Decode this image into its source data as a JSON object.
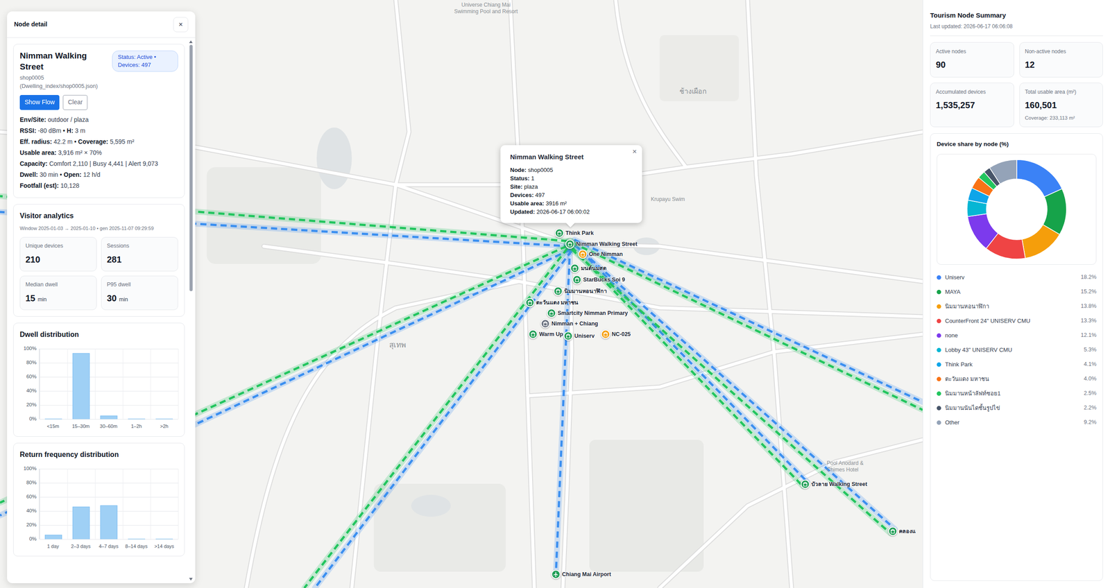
{
  "map": {
    "labels": [
      {
        "text": "Universe Chiang Mai Swimming Pool and Resort"
      },
      {
        "text": "ช้างเผือก"
      },
      {
        "text": "Krupayu Swim"
      },
      {
        "text": "สุเทพ"
      },
      {
        "text": "Pool Anodard & Chimes Hotel"
      }
    ],
    "flows": [
      {
        "color": "#22c55e"
      },
      {
        "color": "#3b8ff0"
      },
      {
        "color": "#22c55e"
      },
      {
        "color": "#3b8ff0"
      },
      {
        "color": "#22c55e"
      },
      {
        "color": "#3b8ff0"
      },
      {
        "color": "#3b8ff0"
      },
      {
        "color": "#22c55e"
      },
      {
        "color": "#3b8ff0"
      },
      {
        "color": "#22c55e"
      },
      {
        "color": "#3b8ff0"
      },
      {
        "color": "#22c55e"
      },
      {
        "color": "#3b8ff0"
      }
    ],
    "pins": [
      {
        "name": "Think Park",
        "color": "#1f9d55",
        "kind": "shop"
      },
      {
        "name": "Nimman Walking Street",
        "color": "#1f9d55",
        "kind": "hub"
      },
      {
        "name": "One Nimman",
        "color": "#f59e0b",
        "kind": "shop"
      },
      {
        "name": "มนต์นมสด",
        "color": "#1f9d55",
        "kind": "shop"
      },
      {
        "name": "StarBucks Soi 9",
        "color": "#1f9d55",
        "kind": "shop"
      },
      {
        "name": "นิมมานหอนาฬิกา",
        "color": "#1f9d55",
        "kind": "shop"
      },
      {
        "name": "ตะวันแดง มหาชน",
        "color": "#1f9d55",
        "kind": "shop"
      },
      {
        "name": "Smartcity Nimman Primary",
        "color": "#1f9d55",
        "kind": "shop"
      },
      {
        "name": "Nimman + Chiang",
        "color": "#6b7280",
        "kind": "shop"
      },
      {
        "name": "Warm Up",
        "color": "#1f9d55",
        "kind": "shop"
      },
      {
        "name": "Uniserv",
        "color": "#1f9d55",
        "kind": "shop"
      },
      {
        "name": "NC-025",
        "color": "#f59e0b",
        "kind": "shop"
      },
      {
        "name": "บัวลาย Walking Street",
        "color": "#1f9d55",
        "kind": "shop"
      },
      {
        "name": "คลองแ",
        "color": "#1f9d55",
        "kind": "shop"
      },
      {
        "name": "Chiang Mai Airport",
        "color": "#1f9d55",
        "kind": "airport"
      }
    ],
    "popup": {
      "title": "Nimman Walking Street",
      "close": "×",
      "rows": [
        {
          "label": "Node:",
          "value": "shop0005"
        },
        {
          "label": "Status:",
          "value": "1"
        },
        {
          "label": "Site:",
          "value": "plaza"
        },
        {
          "label": "Devices:",
          "value": "497"
        },
        {
          "label": "Usable area:",
          "value": "3916 m²"
        },
        {
          "label": "Updated:",
          "value": "2026-06-17 06:00:02"
        }
      ]
    }
  },
  "node_detail": {
    "header": "Node detail",
    "close": "×",
    "title": "Nimman Walking Street",
    "badge": "Status: Active • Devices: 497",
    "node_id": "shop0005",
    "path": "(Dwelling_index/shop0005.json)",
    "buttons": [
      {
        "label": "Show Flow",
        "kind": "primary"
      },
      {
        "label": "Clear",
        "kind": "secondary"
      }
    ],
    "separator": "•",
    "info": [
      {
        "parts": [
          {
            "label": "Env/Site:",
            "value": "outdoor / plaza"
          }
        ]
      },
      {
        "parts": [
          {
            "label": "RSSI:",
            "value": "-80 dBm"
          },
          {
            "label": "H:",
            "value": "3 m"
          }
        ]
      },
      {
        "parts": [
          {
            "label": "Eff. radius:",
            "value": "42.2 m"
          },
          {
            "label": "Coverage:",
            "value": "5,595 m²"
          }
        ]
      },
      {
        "parts": [
          {
            "label": "Usable area:",
            "value": "3,916 m² × 70%"
          }
        ]
      },
      {
        "parts": [
          {
            "label": "Capacity:",
            "value": "Comfort 2,110 | Busy 4,441 | Alert 9,073"
          }
        ]
      },
      {
        "parts": [
          {
            "label": "Dwell:",
            "value": "30 min"
          },
          {
            "label": "Open:",
            "value": "12 h/d"
          }
        ]
      },
      {
        "parts": [
          {
            "label": "Footfall (est):",
            "value": "10,128"
          }
        ]
      }
    ]
  },
  "visitor": {
    "title": "Visitor analytics",
    "window": "Window 2025-01-03 → 2025-01-10 • gen 2025-11-07 09:29:59",
    "stats": [
      {
        "label": "Unique devices",
        "value": "210"
      },
      {
        "label": "Sessions",
        "value": "281"
      },
      {
        "label": "Median dwell",
        "value": "15",
        "unit": "min"
      },
      {
        "label": "P95 dwell",
        "value": "30",
        "unit": "min"
      }
    ]
  },
  "charts": [
    {
      "title": "Dwell distribution",
      "y_ticks": [
        "100%",
        "80%",
        "60%",
        "40%",
        "20%",
        "0%"
      ],
      "categories": [
        "<15m",
        "15–30m",
        "30–60m",
        "1–2h",
        ">2h"
      ],
      "values": [
        0,
        94,
        5,
        0,
        0
      ]
    },
    {
      "title": "Return frequency distribution",
      "y_ticks": [
        "100%",
        "80%",
        "60%",
        "40%",
        "20%",
        "0%"
      ],
      "categories": [
        "1 day",
        "2–3 days",
        "4–7 days",
        "8–14 days",
        ">14 days"
      ],
      "values": [
        6,
        46,
        48,
        0,
        0
      ]
    }
  ],
  "summary": {
    "title": "Tourism Node Summary",
    "updated": "Last updated: 2026-06-17 06:06:08",
    "stats": [
      {
        "label": "Active nodes",
        "value": "90"
      },
      {
        "label": "Non-active nodes",
        "value": "12"
      },
      {
        "label": "Accumulated devices",
        "value": "1,535,257"
      },
      {
        "label": "Total usable area (m²)",
        "value": "160,501",
        "note": "Coverage: 233,113 m²"
      }
    ],
    "share": {
      "title": "Device share by node (%)",
      "items": [
        {
          "name": "Uniserv",
          "pct": "18.2%",
          "value": 18.2,
          "color": "#3b82f6"
        },
        {
          "name": "MAYA",
          "pct": "15.2%",
          "value": 15.2,
          "color": "#16a34a"
        },
        {
          "name": "นิมมานหอนาฬิกา",
          "pct": "13.8%",
          "value": 13.8,
          "color": "#f59e0b"
        },
        {
          "name": "CounterFront 24\" UNISERV CMU",
          "pct": "13.3%",
          "value": 13.3,
          "color": "#ef4444"
        },
        {
          "name": "none",
          "pct": "12.1%",
          "value": 12.1,
          "color": "#7c3aed"
        },
        {
          "name": "Lobby 43\" UNISERV CMU",
          "pct": "5.3%",
          "value": 5.3,
          "color": "#06b6d4"
        },
        {
          "name": "Think Park",
          "pct": "4.1%",
          "value": 4.1,
          "color": "#0ea5e9"
        },
        {
          "name": "ตะวันแดง มหาชน",
          "pct": "4.0%",
          "value": 4.0,
          "color": "#f97316"
        },
        {
          "name": "นิมมานหน้าลัฟท์ซอย1",
          "pct": "2.5%",
          "value": 2.5,
          "color": "#22c55e"
        },
        {
          "name": "นิมมานนันไดชั้นรูปไข่",
          "pct": "2.2%",
          "value": 2.2,
          "color": "#475569"
        },
        {
          "name": "Other",
          "pct": "9.2%",
          "value": 9.2,
          "color": "#94a3b8"
        }
      ]
    }
  }
}
